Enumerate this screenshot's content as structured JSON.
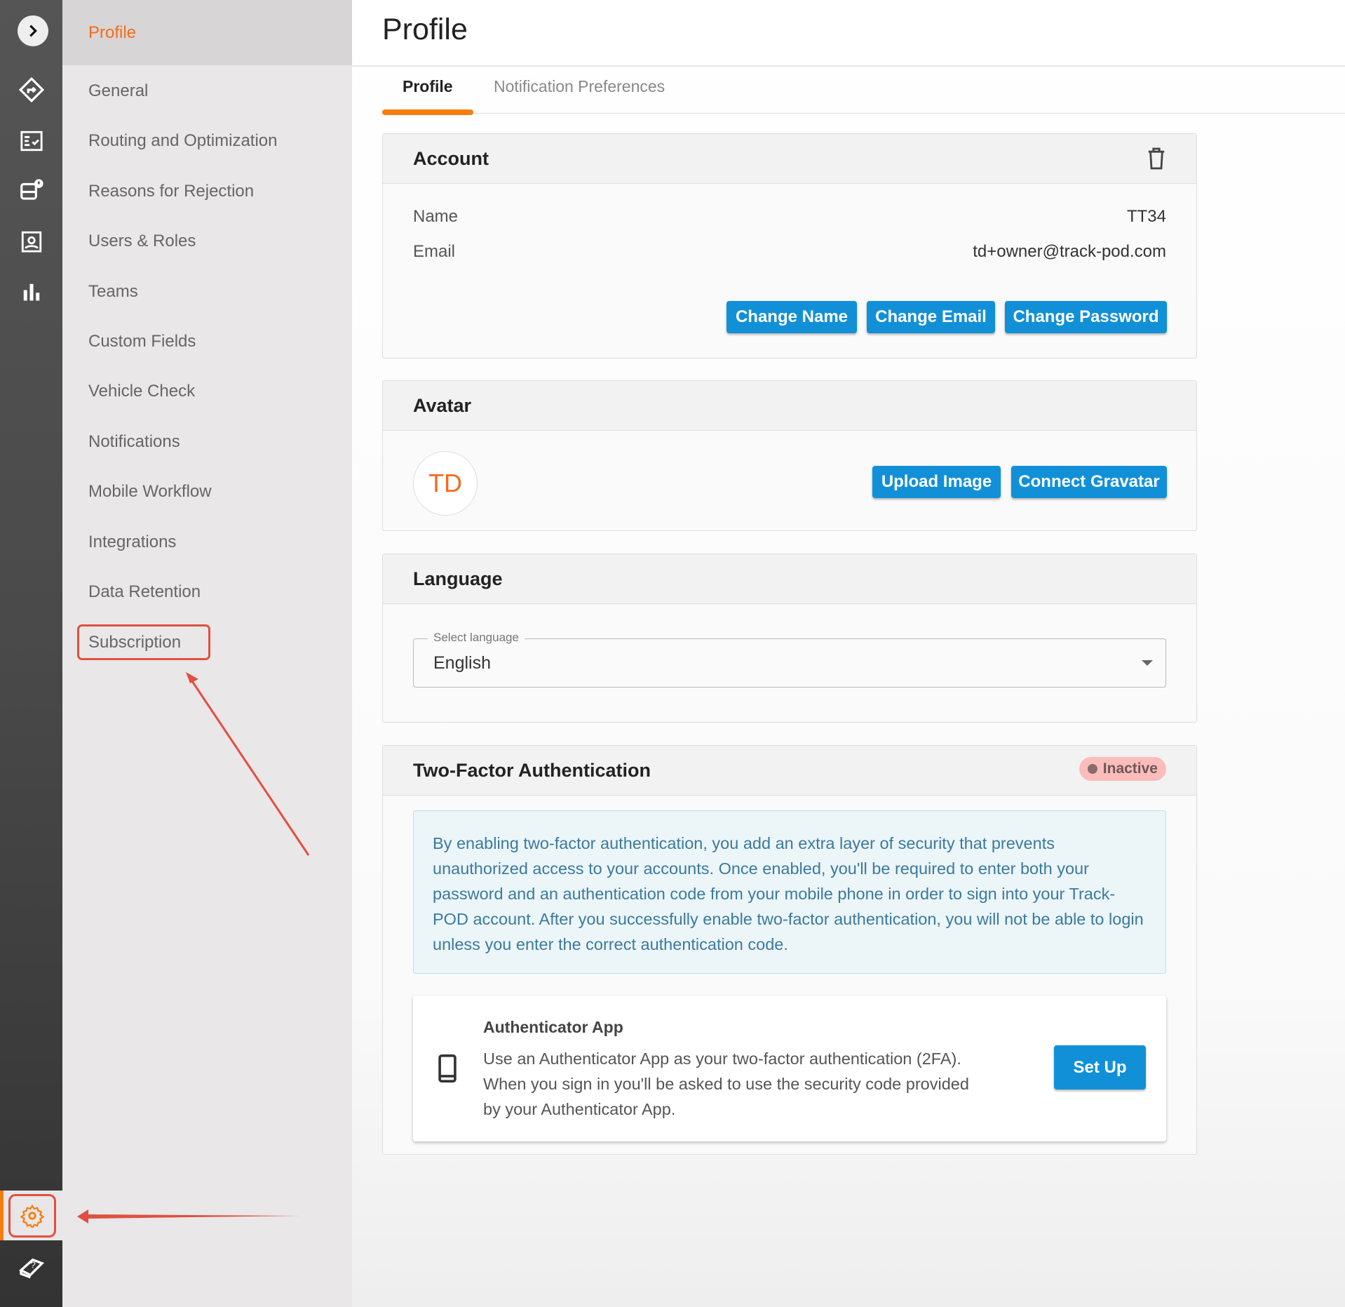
{
  "header": {
    "title": "Profile"
  },
  "tabs": [
    {
      "label": "Profile",
      "active": true
    },
    {
      "label": "Notification Preferences",
      "active": false
    }
  ],
  "sidebar": {
    "items": [
      {
        "label": "Profile",
        "selected": true
      },
      {
        "label": "General"
      },
      {
        "label": "Routing and Optimization"
      },
      {
        "label": "Reasons for Rejection"
      },
      {
        "label": "Users & Roles"
      },
      {
        "label": "Teams"
      },
      {
        "label": "Custom Fields"
      },
      {
        "label": "Vehicle Check"
      },
      {
        "label": "Notifications"
      },
      {
        "label": "Mobile Workflow"
      },
      {
        "label": "Integrations"
      },
      {
        "label": "Data Retention"
      },
      {
        "label": "Subscription"
      }
    ]
  },
  "account": {
    "title": "Account",
    "name_label": "Name",
    "name_value": "TT34",
    "email_label": "Email",
    "email_value": "td+owner@track-pod.com",
    "change_name": "Change Name",
    "change_email": "Change Email",
    "change_password": "Change Password"
  },
  "avatar": {
    "title": "Avatar",
    "initials": "TD",
    "upload": "Upload Image",
    "gravatar": "Connect Gravatar"
  },
  "language": {
    "title": "Language",
    "label": "Select language",
    "value": "English"
  },
  "twofa": {
    "title": "Two-Factor Authentication",
    "status": "Inactive",
    "info": "By enabling two-factor authentication, you add an extra layer of security that prevents unauthorized access to your accounts. Once enabled, you'll be required to enter both your password and an authentication code from your mobile phone in order to sign into your Track-POD account. After you successfully enable two-factor authentication, you will not be able to login unless you enter the correct authentication code.",
    "app_title": "Authenticator App",
    "app_desc": "Use an Authenticator App as your two-factor authentication (2FA). When you sign in you'll be asked to use the security code provided by your Authenticator App.",
    "setup": "Set Up"
  },
  "colors": {
    "accent": "#f26b1d",
    "button": "#1190d8",
    "annotation": "#e05040"
  }
}
